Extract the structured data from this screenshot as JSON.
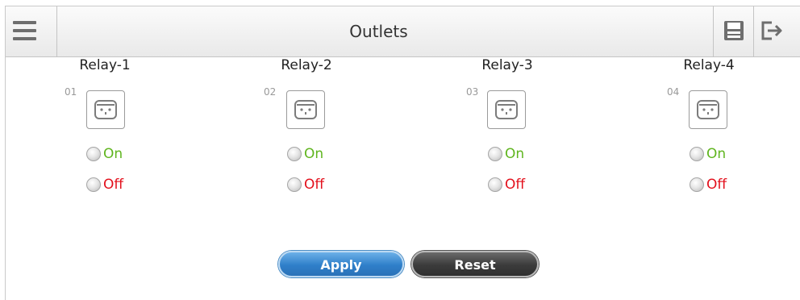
{
  "header": {
    "title": "Outlets",
    "menu_icon": "hamburger-menu-icon",
    "save_icon": "floppy-disk-save-icon",
    "logout_icon": "logout-icon"
  },
  "relays": [
    {
      "name": "Relay-1",
      "outlet_number": "01",
      "on_label": "On",
      "off_label": "Off"
    },
    {
      "name": "Relay-2",
      "outlet_number": "02",
      "on_label": "On",
      "off_label": "Off"
    },
    {
      "name": "Relay-3",
      "outlet_number": "03",
      "on_label": "On",
      "off_label": "Off"
    },
    {
      "name": "Relay-4",
      "outlet_number": "04",
      "on_label": "On",
      "off_label": "Off"
    }
  ],
  "actions": {
    "apply_label": "Apply",
    "reset_label": "Reset"
  },
  "colors": {
    "on": "#5fb51e",
    "off": "#e3101c",
    "apply": "#2f7fc9",
    "reset": "#3b3b3b"
  }
}
